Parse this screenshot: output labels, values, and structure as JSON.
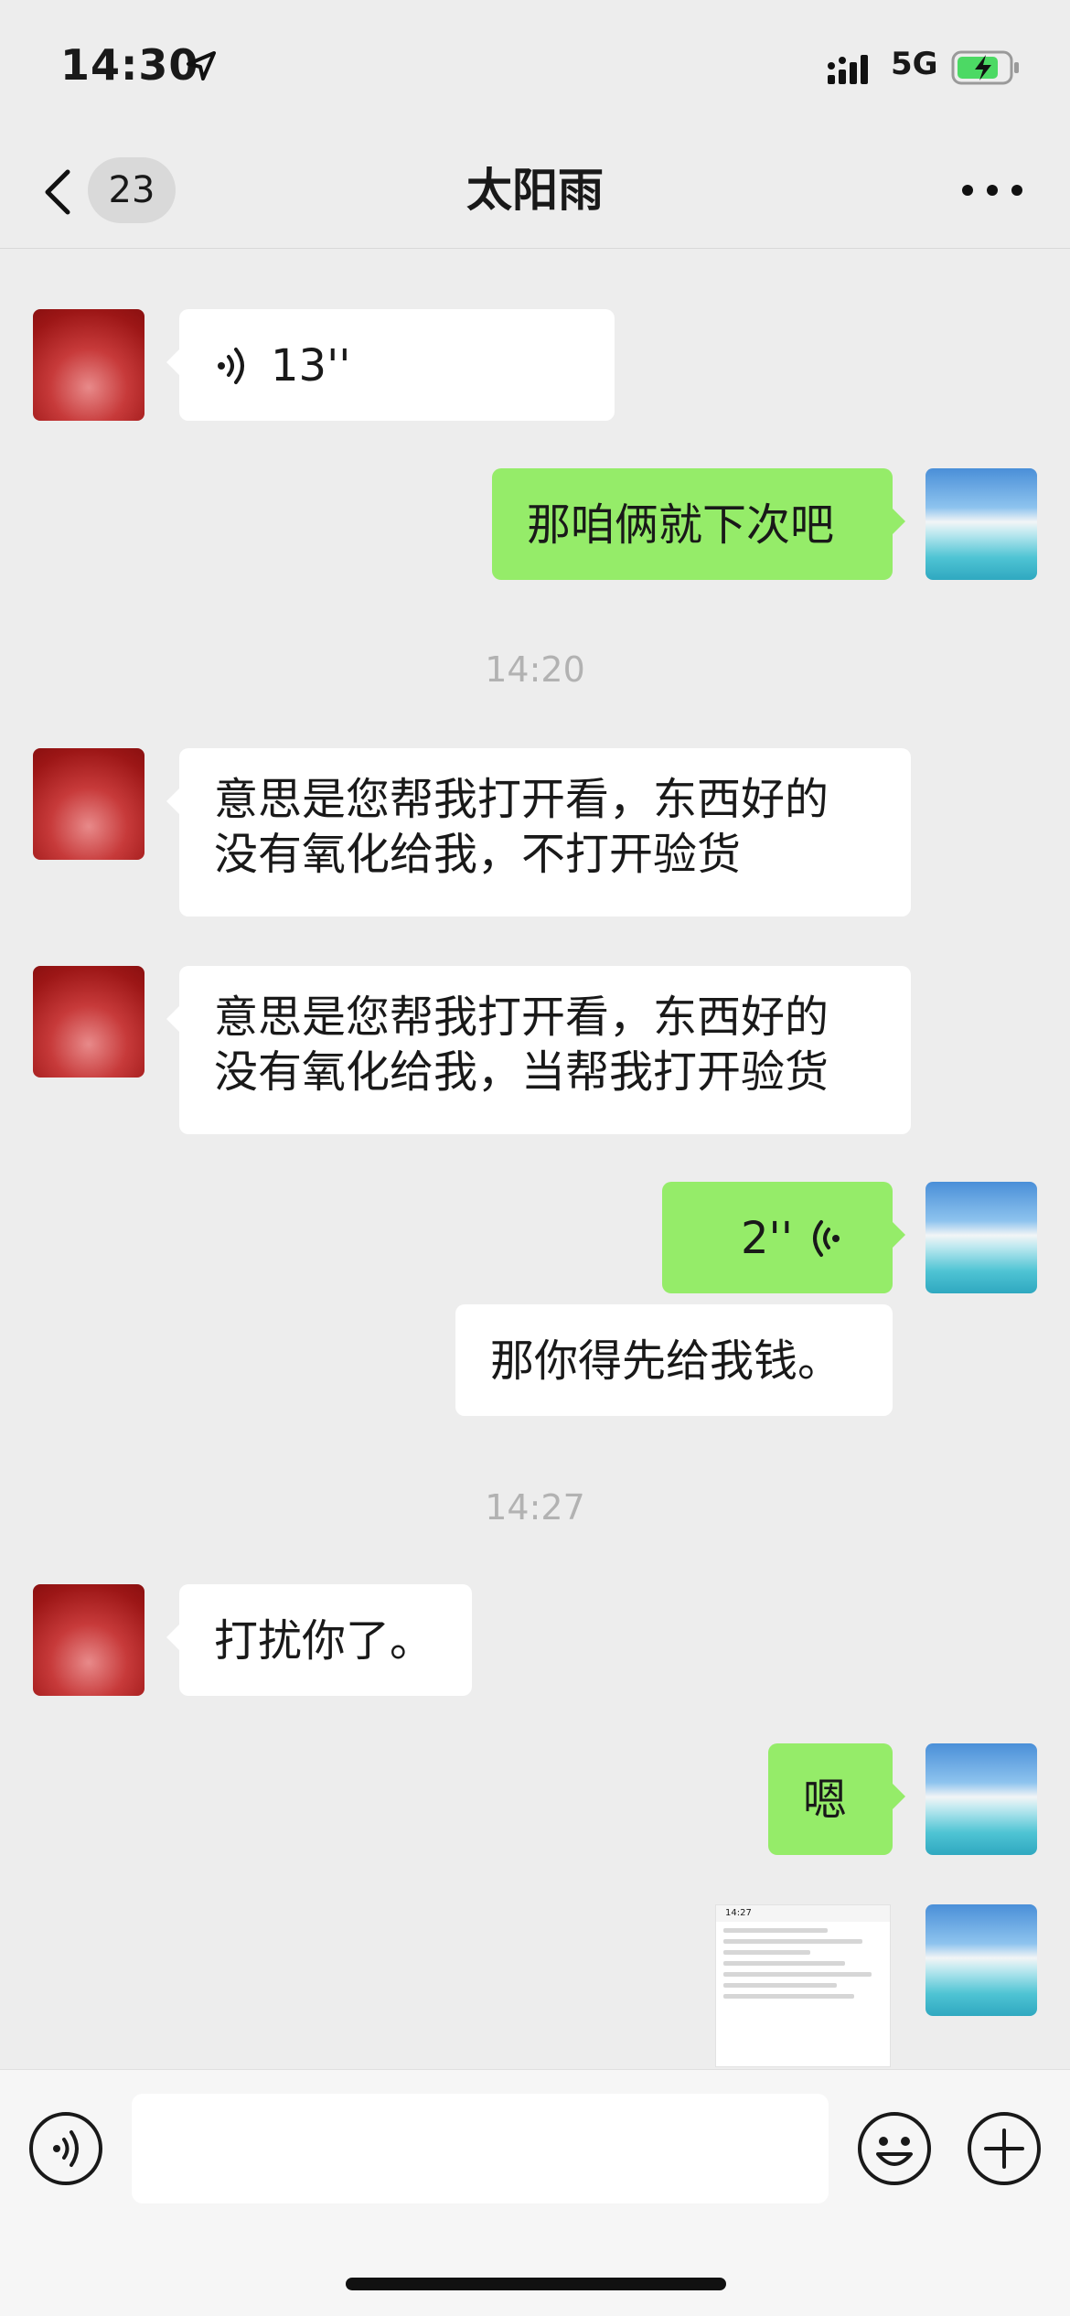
{
  "status_bar": {
    "time": "14:30",
    "network": "5G"
  },
  "nav": {
    "unread_count": "23",
    "title": "太阳雨"
  },
  "messages": [
    {
      "kind": "voice",
      "side": "in",
      "duration": "13''"
    },
    {
      "kind": "text",
      "side": "out",
      "text": "那咱俩就下次吧"
    },
    {
      "kind": "time",
      "text": "14:20"
    },
    {
      "kind": "text",
      "side": "in",
      "lines": [
        "意思是您帮我打开看，东西好的",
        "没有氧化给我，不打开验货"
      ]
    },
    {
      "kind": "text",
      "side": "in",
      "lines": [
        "意思是您帮我打开看，东西好的",
        "没有氧化给我，当帮我打开验货"
      ]
    },
    {
      "kind": "voice",
      "side": "out",
      "duration": "2''"
    },
    {
      "kind": "text",
      "side": "out",
      "text": "那你得先给我钱。"
    },
    {
      "kind": "time",
      "text": "14:27"
    },
    {
      "kind": "text",
      "side": "in",
      "text": "打扰你了。"
    },
    {
      "kind": "text",
      "side": "out",
      "text": "嗯"
    },
    {
      "kind": "image",
      "side": "out",
      "thumb_time": "14:27"
    }
  ],
  "colors": {
    "background": "#ededed",
    "outgoing_bubble": "#95ec69",
    "incoming_bubble": "#ffffff",
    "timestamp": "#b2b2b2"
  },
  "icons": {
    "back": "chevron-left-icon",
    "more": "more-icon",
    "voice_toggle": "voice-icon",
    "emoji": "emoji-icon",
    "plus": "plus-icon"
  }
}
